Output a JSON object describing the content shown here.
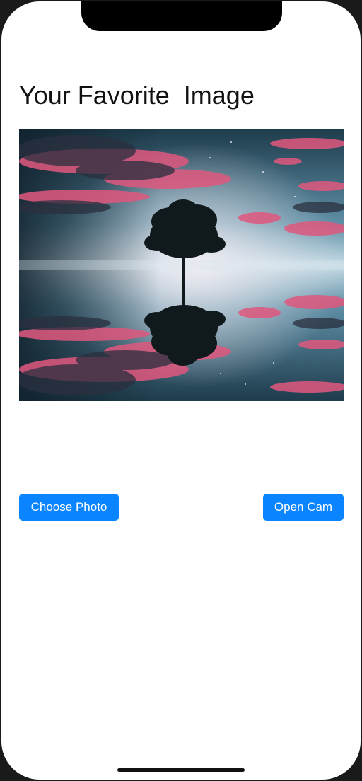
{
  "page": {
    "title": "Your Favorite  Image"
  },
  "photo": {
    "subject": "tree reflected on water under pink clouds"
  },
  "buttons": {
    "choose_photo": "Choose Photo",
    "open_cam": "Open Cam"
  },
  "colors": {
    "accent": "#0a84ff",
    "background": "#ffffff",
    "sky_top": "#1c3a4a",
    "sky_mid": "#a9c7d6",
    "cloud_pink": "#e8557a"
  },
  "icons": {
    "notch": "device-notch",
    "home_indicator": "home-indicator"
  }
}
